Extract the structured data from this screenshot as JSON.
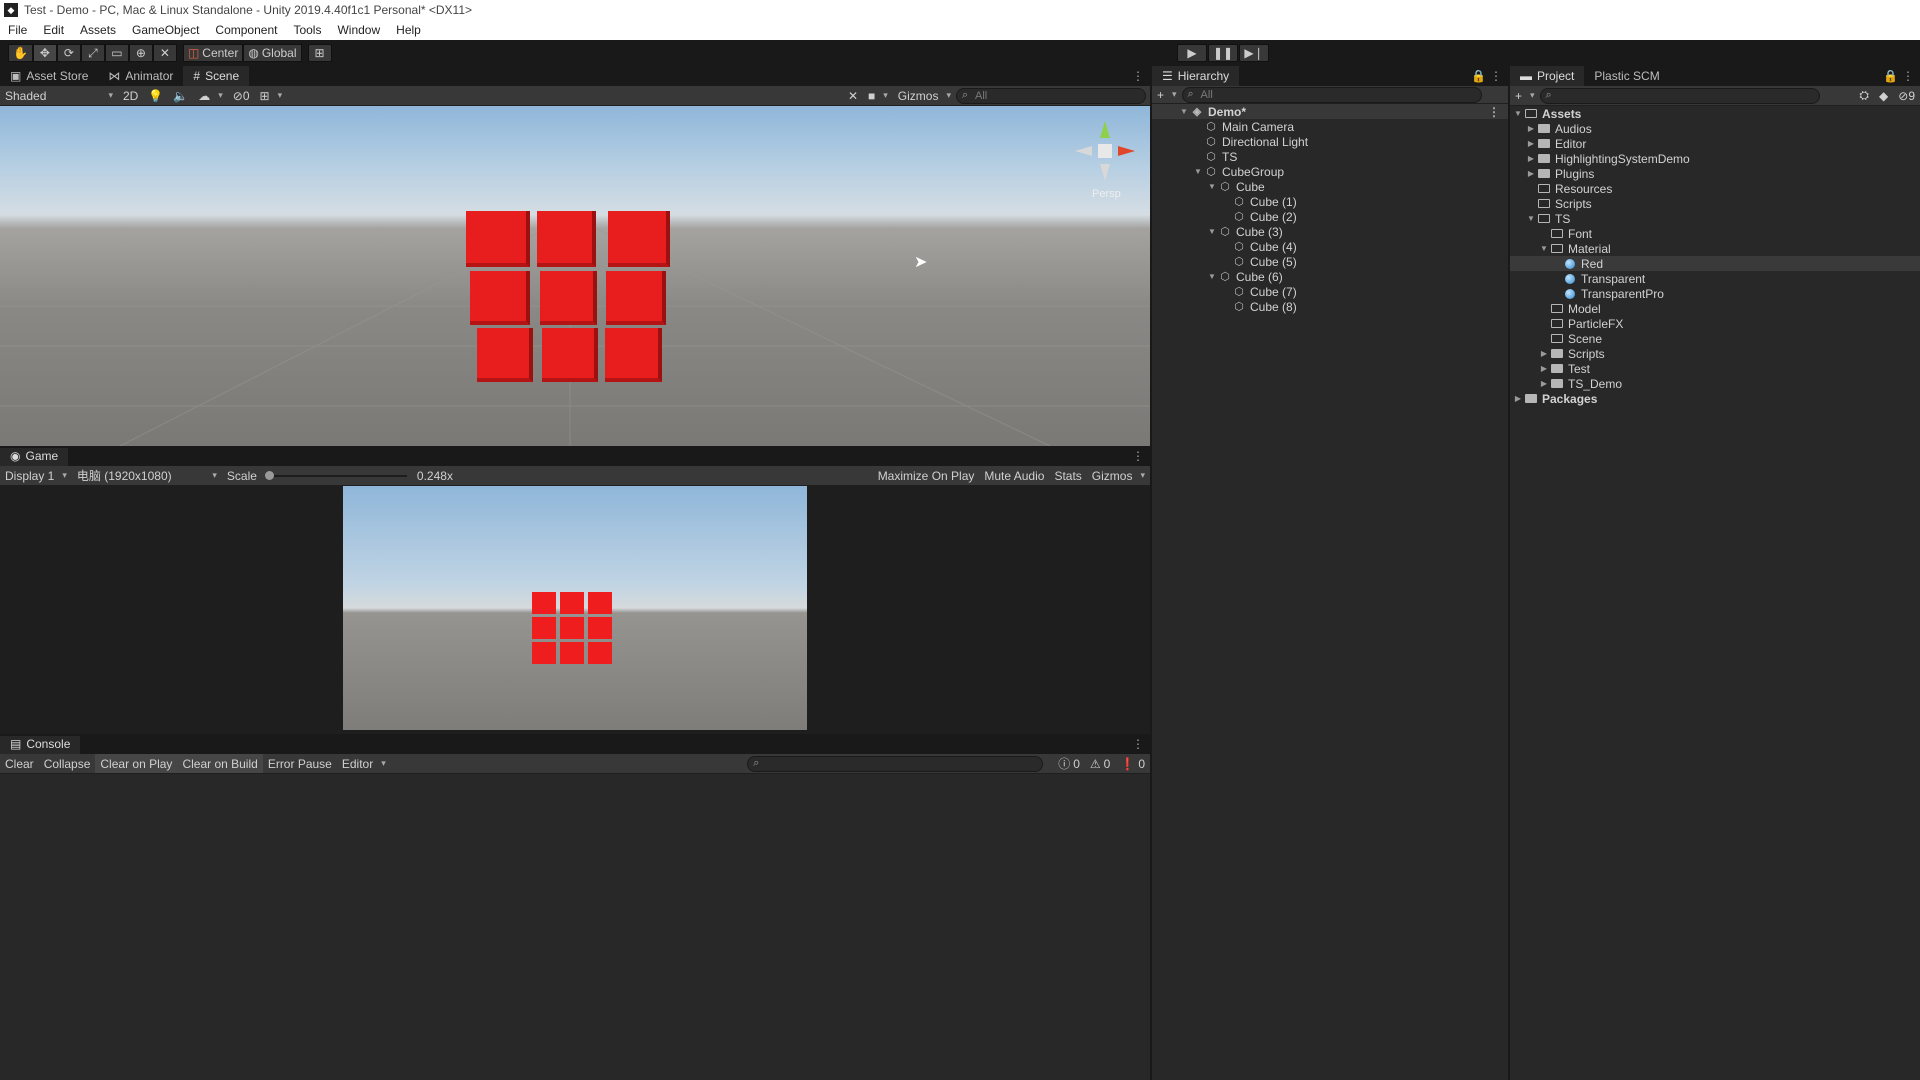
{
  "window": {
    "title": "Test - Demo - PC, Mac & Linux Standalone - Unity 2019.4.40f1c1 Personal* <DX11>"
  },
  "menu": [
    "File",
    "Edit",
    "Assets",
    "GameObject",
    "Component",
    "Tools",
    "Window",
    "Help"
  ],
  "toolbar": {
    "center_label": "Center",
    "global_label": "Global"
  },
  "scene_panel": {
    "tabs": [
      "Asset Store",
      "Animator",
      "Scene"
    ],
    "shading": "Shaded",
    "mode_2d": "2D",
    "hidden_count": "0",
    "gizmos": "Gizmos",
    "search_placeholder": "All",
    "persp": "Persp"
  },
  "game_panel": {
    "tab": "Game",
    "display": "Display 1",
    "resolution": "电脑 (1920x1080)",
    "scale_label": "Scale",
    "scale_value": "0.248x",
    "maximize": "Maximize On Play",
    "mute": "Mute Audio",
    "stats": "Stats",
    "gizmos": "Gizmos"
  },
  "console_panel": {
    "tab": "Console",
    "clear": "Clear",
    "collapse": "Collapse",
    "clear_on_play": "Clear on Play",
    "clear_on_build": "Clear on Build",
    "error_pause": "Error Pause",
    "editor": "Editor",
    "count_log": "0",
    "count_warn": "0",
    "count_err": "0"
  },
  "hierarchy": {
    "tab": "Hierarchy",
    "search_placeholder": "All",
    "items": [
      {
        "label": "Demo*",
        "depth": 0,
        "arrow": "▼",
        "type": "scene"
      },
      {
        "label": "Main Camera",
        "depth": 1,
        "arrow": "",
        "type": "go"
      },
      {
        "label": "Directional Light",
        "depth": 1,
        "arrow": "",
        "type": "go"
      },
      {
        "label": "TS",
        "depth": 1,
        "arrow": "",
        "type": "go"
      },
      {
        "label": "CubeGroup",
        "depth": 1,
        "arrow": "▼",
        "type": "go"
      },
      {
        "label": "Cube",
        "depth": 2,
        "arrow": "▼",
        "type": "go"
      },
      {
        "label": "Cube (1)",
        "depth": 3,
        "arrow": "",
        "type": "go"
      },
      {
        "label": "Cube (2)",
        "depth": 3,
        "arrow": "",
        "type": "go"
      },
      {
        "label": "Cube (3)",
        "depth": 2,
        "arrow": "▼",
        "type": "go"
      },
      {
        "label": "Cube (4)",
        "depth": 3,
        "arrow": "",
        "type": "go"
      },
      {
        "label": "Cube (5)",
        "depth": 3,
        "arrow": "",
        "type": "go"
      },
      {
        "label": "Cube (6)",
        "depth": 2,
        "arrow": "▼",
        "type": "go"
      },
      {
        "label": "Cube (7)",
        "depth": 3,
        "arrow": "",
        "type": "go"
      },
      {
        "label": "Cube (8)",
        "depth": 3,
        "arrow": "",
        "type": "go"
      }
    ]
  },
  "project": {
    "tabs": [
      "Project",
      "Plastic SCM"
    ],
    "hidden_count": "9",
    "items": [
      {
        "label": "Assets",
        "depth": 0,
        "arrow": "▼",
        "type": "folder-open",
        "bold": true
      },
      {
        "label": "Audios",
        "depth": 1,
        "arrow": "▶",
        "type": "folder"
      },
      {
        "label": "Editor",
        "depth": 1,
        "arrow": "▶",
        "type": "folder"
      },
      {
        "label": "HighlightingSystemDemo",
        "depth": 1,
        "arrow": "▶",
        "type": "folder"
      },
      {
        "label": "Plugins",
        "depth": 1,
        "arrow": "▶",
        "type": "folder"
      },
      {
        "label": "Resources",
        "depth": 1,
        "arrow": "",
        "type": "folder-open"
      },
      {
        "label": "Scripts",
        "depth": 1,
        "arrow": "",
        "type": "folder-open"
      },
      {
        "label": "TS",
        "depth": 1,
        "arrow": "▼",
        "type": "folder-open"
      },
      {
        "label": "Font",
        "depth": 2,
        "arrow": "",
        "type": "folder-open"
      },
      {
        "label": "Material",
        "depth": 2,
        "arrow": "▼",
        "type": "folder-open"
      },
      {
        "label": "Red",
        "depth": 3,
        "arrow": "",
        "type": "material",
        "selected": true
      },
      {
        "label": "Transparent",
        "depth": 3,
        "arrow": "",
        "type": "material"
      },
      {
        "label": "TransparentPro",
        "depth": 3,
        "arrow": "",
        "type": "material"
      },
      {
        "label": "Model",
        "depth": 2,
        "arrow": "",
        "type": "folder-open"
      },
      {
        "label": "ParticleFX",
        "depth": 2,
        "arrow": "",
        "type": "folder-open"
      },
      {
        "label": "Scene",
        "depth": 2,
        "arrow": "",
        "type": "folder-open"
      },
      {
        "label": "Scripts",
        "depth": 2,
        "arrow": "▶",
        "type": "folder"
      },
      {
        "label": "Test",
        "depth": 2,
        "arrow": "▶",
        "type": "folder"
      },
      {
        "label": "TS_Demo",
        "depth": 2,
        "arrow": "▶",
        "type": "folder"
      },
      {
        "label": "Packages",
        "depth": 0,
        "arrow": "▶",
        "type": "folder",
        "bold": true
      }
    ]
  },
  "colors": {
    "cube": "#e81d1d",
    "selection": "#3a3a3a",
    "panel": "#282828",
    "toolbar": "#191919"
  }
}
